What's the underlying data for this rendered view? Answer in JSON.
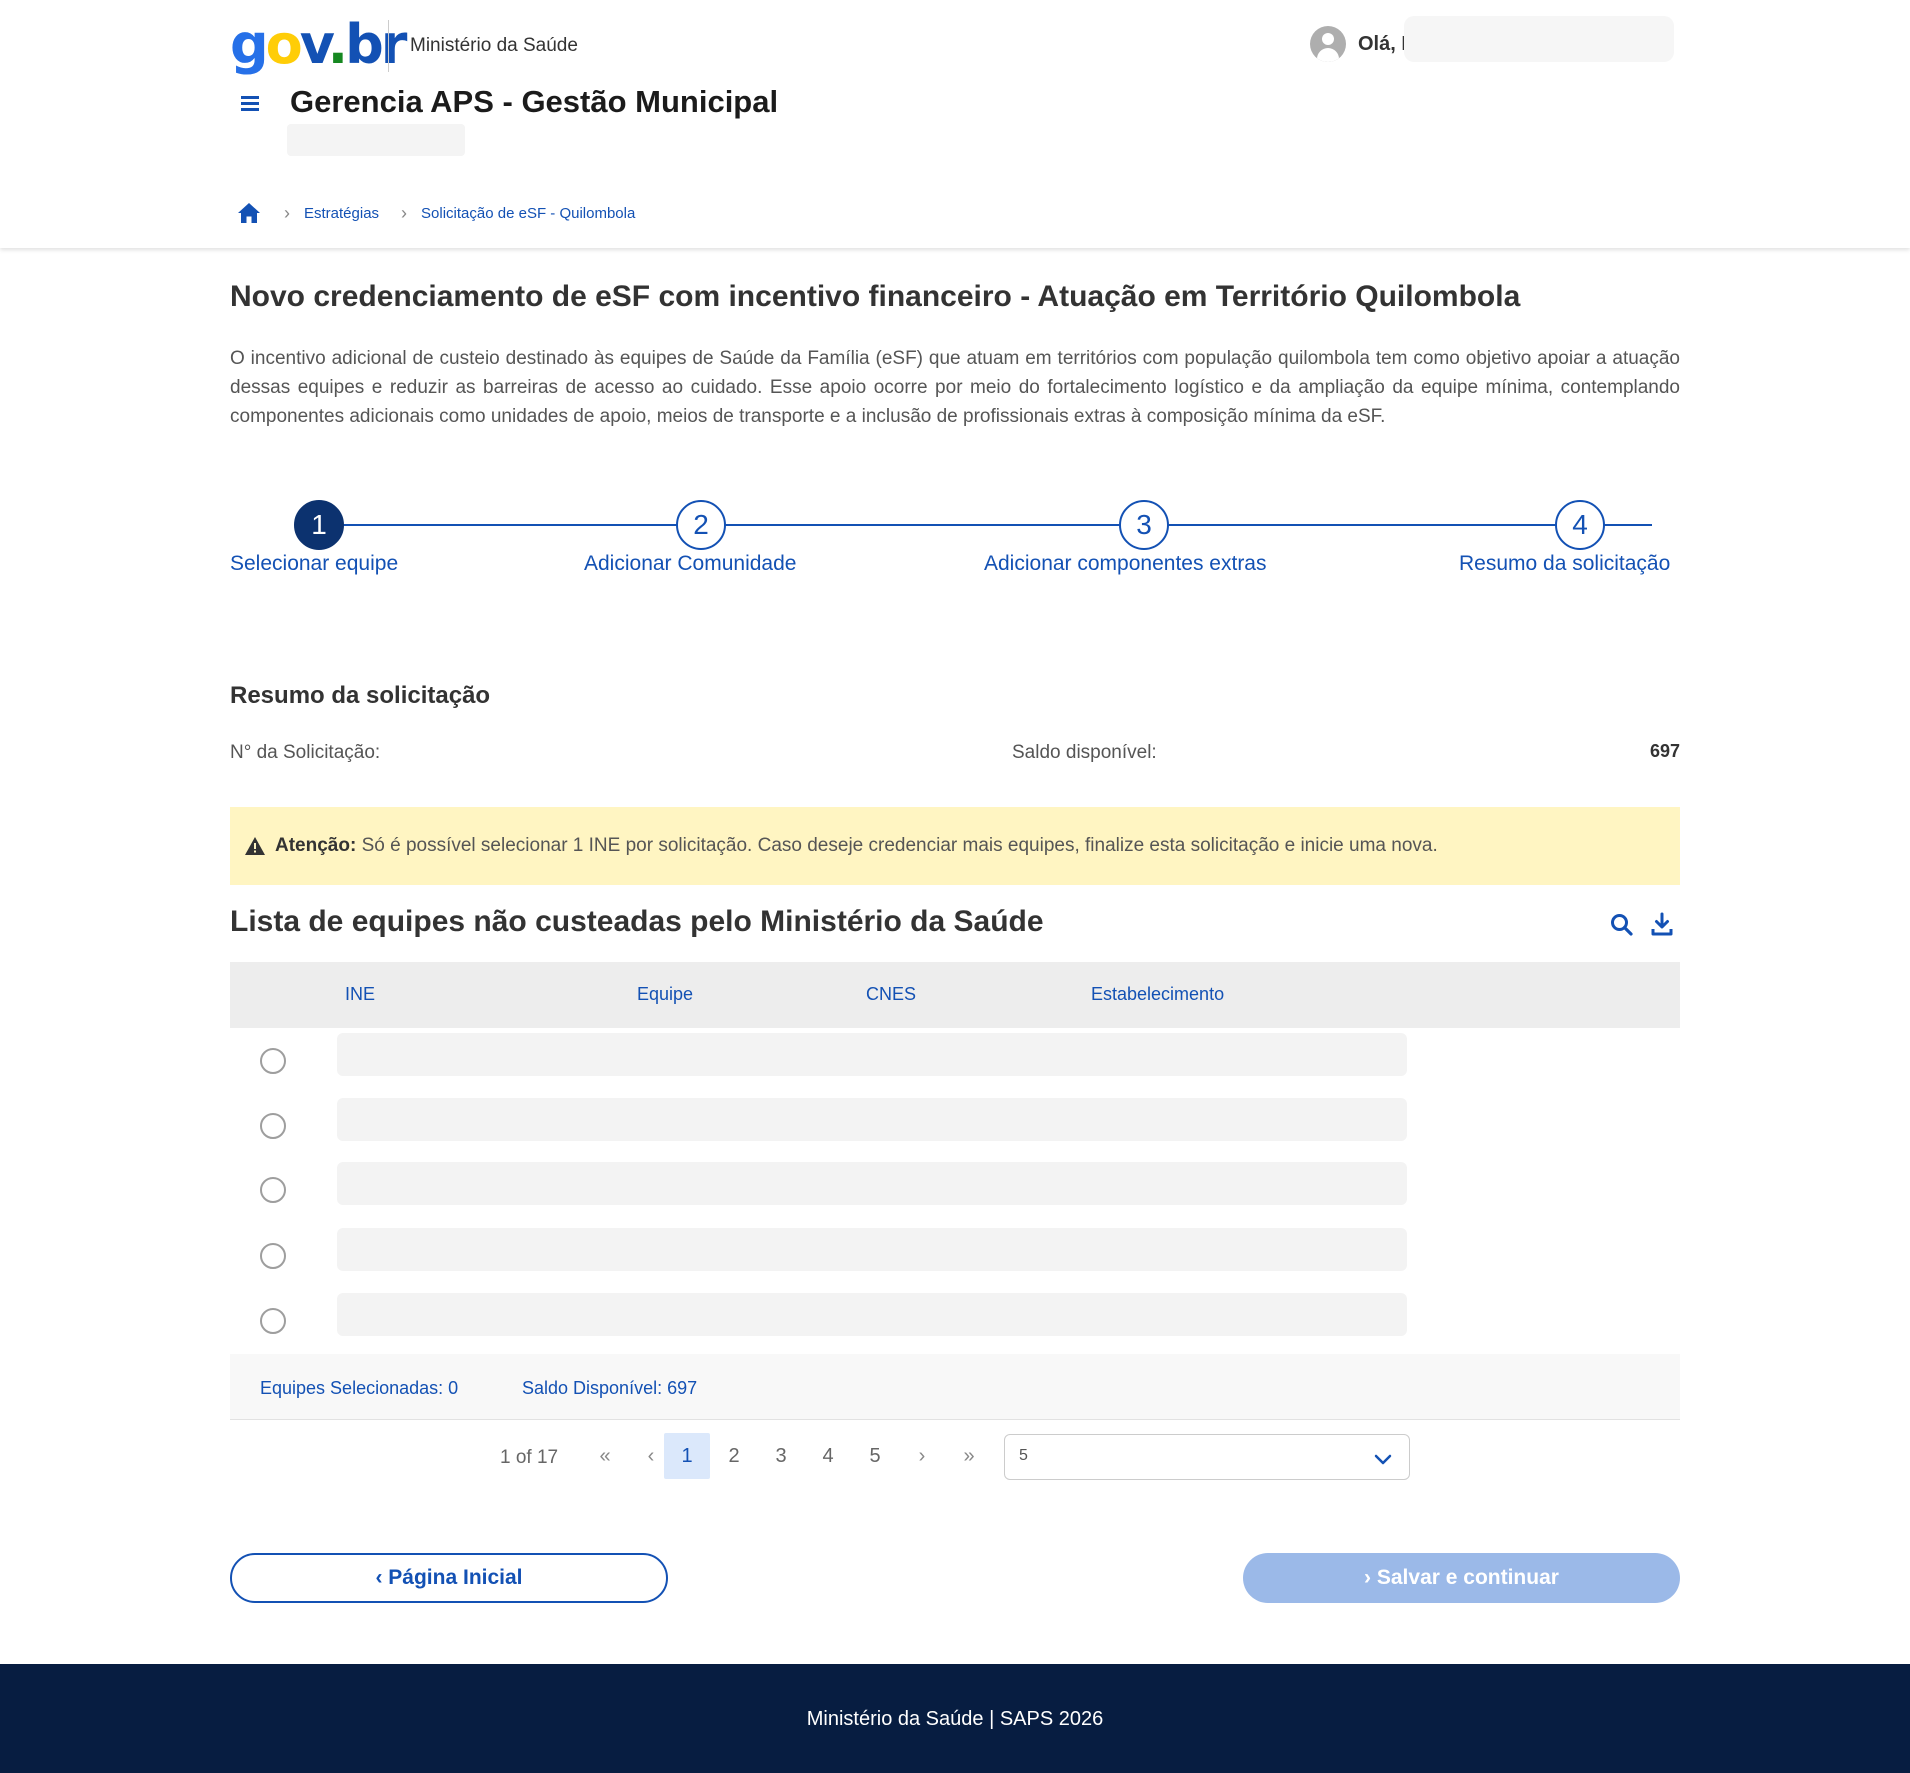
{
  "header": {
    "logo": "gov.br",
    "ministry": "Ministério da Saúde",
    "greeting": "Olá, I",
    "app_title": "Gerencia APS - Gestão Municipal"
  },
  "breadcrumb": {
    "items": [
      "Estratégias",
      "Solicitação de eSF - Quilombola"
    ]
  },
  "page": {
    "title": "Novo credenciamento de eSF com incentivo financeiro - Atuação em Território Quilombola",
    "intro": "O incentivo adicional de custeio destinado às equipes de Saúde da Família (eSF) que atuam em territórios com população quilombola tem como objetivo apoiar a atuação dessas equipes e reduzir as barreiras de acesso ao cuidado. Esse apoio ocorre por meio do fortalecimento logístico e da ampliação da equipe mínima, contemplando componentes adicionais como unidades de apoio, meios de transporte e a inclusão de profissionais extras à composição mínima da eSF."
  },
  "stepper": {
    "steps": [
      {
        "number": "1",
        "label": "Selecionar equipe",
        "active": true
      },
      {
        "number": "2",
        "label": "Adicionar Comunidade",
        "active": false
      },
      {
        "number": "3",
        "label": "Adicionar componentes extras",
        "active": false
      },
      {
        "number": "4",
        "label": "Resumo da solicitação",
        "active": false
      }
    ]
  },
  "summary": {
    "title": "Resumo da solicitação",
    "request_label": "N° da Solicitação:",
    "balance_label": "Saldo disponível:",
    "balance_value": "697"
  },
  "alert": {
    "strong": "Atenção:",
    "text": " Só é possível selecionar 1 INE por solicitação. Caso deseje credenciar mais equipes, finalize esta solicitação e inicie uma nova."
  },
  "table": {
    "title": "Lista de equipes não custeadas pelo Ministério da Saúde",
    "columns": [
      "INE",
      "Equipe",
      "CNES",
      "Estabelecimento"
    ],
    "row_count": 5,
    "footer": {
      "selected": "Equipes Selecionadas: 0",
      "balance": "Saldo Disponível: 697"
    }
  },
  "pagination": {
    "info": "1 of 17",
    "pages": [
      "1",
      "2",
      "3",
      "4",
      "5"
    ],
    "current": "1",
    "page_size": "5"
  },
  "actions": {
    "back": "Página Inicial",
    "next": "Salvar e continuar"
  },
  "footer": {
    "text": "Ministério da Saúde | SAPS 2026"
  },
  "colors": {
    "primary": "#1351b4",
    "dark_blue": "#0c326f",
    "footer_bg": "#071d41",
    "alert_bg": "#fff5c2",
    "disabled_btn": "#9bb9e8"
  }
}
